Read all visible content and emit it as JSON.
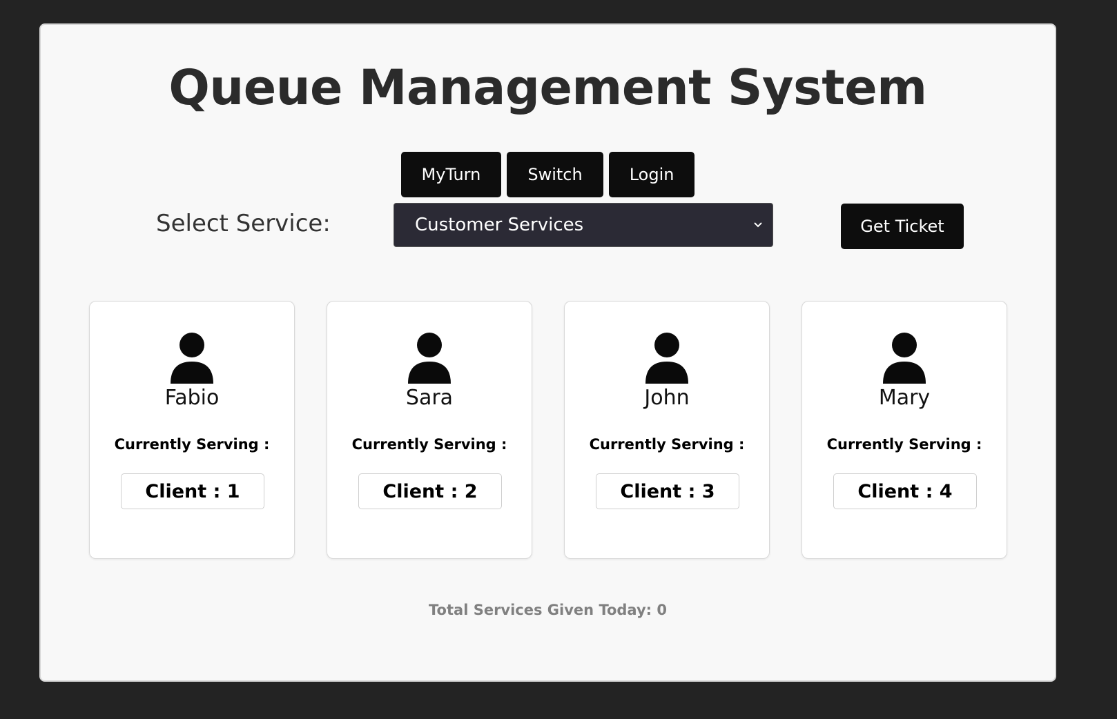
{
  "title": "Queue Management System",
  "nav_buttons": [
    "MyTurn",
    "Switch",
    "Login"
  ],
  "service": {
    "label": "Select Service:",
    "selected": "Customer Services",
    "get_ticket_label": "Get Ticket"
  },
  "agents": [
    {
      "name": "Fabio",
      "serving_label": "Currently Serving :",
      "client": "Client : 1"
    },
    {
      "name": "Sara",
      "serving_label": "Currently Serving :",
      "client": "Client : 2"
    },
    {
      "name": "John",
      "serving_label": "Currently Serving :",
      "client": "Client : 3"
    },
    {
      "name": "Mary",
      "serving_label": "Currently Serving :",
      "client": "Client : 4"
    }
  ],
  "total_services": "Total Services Given Today: 0",
  "colors": {
    "background": "#232323",
    "panel": "#f8f8f8",
    "button": "#0d0d0d",
    "select": "#2b2a35",
    "total_text": "#808080"
  },
  "icons": {
    "avatar": "user-silhouette-icon",
    "select_arrow": "chevron-down-icon"
  }
}
